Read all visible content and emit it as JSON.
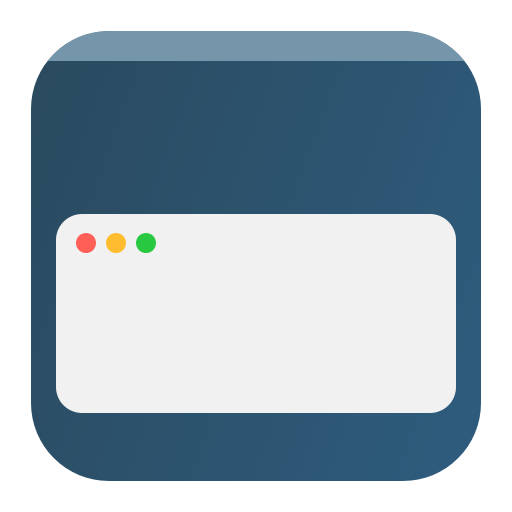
{
  "icon": {
    "name": "browser-window-app-icon",
    "colors": {
      "background_start": "#2a4a5e",
      "background_end": "#2e5c7e",
      "titlebar": "#7595ab",
      "window": "#f1f1f1"
    }
  },
  "window": {
    "controls": [
      {
        "name": "close-button",
        "color": "#ff5f57"
      },
      {
        "name": "minimize-button",
        "color": "#febc2e"
      },
      {
        "name": "zoom-button",
        "color": "#28c840"
      }
    ]
  }
}
